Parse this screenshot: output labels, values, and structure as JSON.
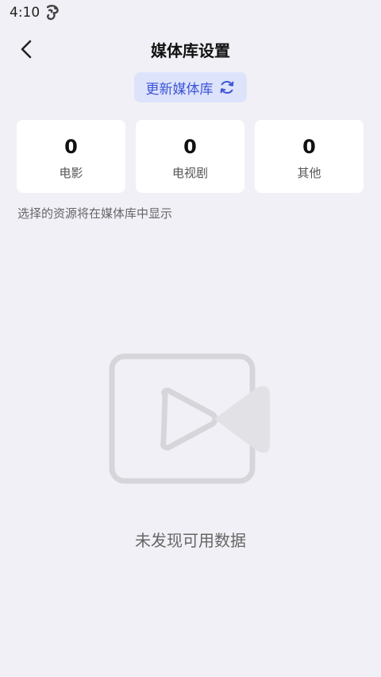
{
  "status_bar": {
    "time": "4:10",
    "notification_icon": "app-notification-icon"
  },
  "header": {
    "title": "媒体库设置",
    "back_icon": "chevron-left-icon"
  },
  "refresh": {
    "label": "更新媒体库",
    "icon": "refresh-icon"
  },
  "stats": [
    {
      "count": "0",
      "label": "电影"
    },
    {
      "count": "0",
      "label": "电视剧"
    },
    {
      "count": "0",
      "label": "其他"
    }
  ],
  "hint": "选择的资源将在媒体库中显示",
  "empty": {
    "icon": "video-camera-icon",
    "text": "未发现可用数据"
  },
  "colors": {
    "background": "#f1f0f6",
    "accent": "#3c54d6",
    "accent_bg": "#dde3fb",
    "card": "#ffffff",
    "illustration": "#d6d6da"
  }
}
